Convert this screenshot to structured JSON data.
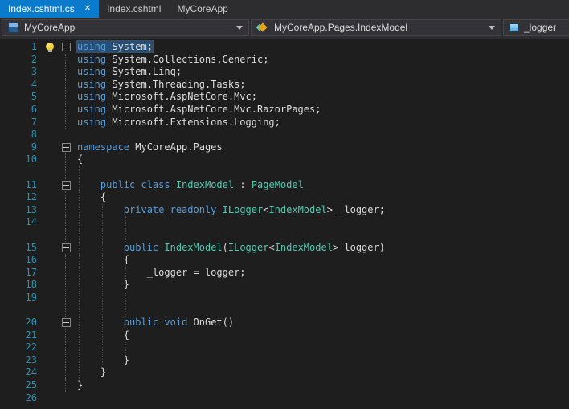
{
  "colors": {
    "bg": "#1e1e1e",
    "tabbar": "#2d2d30",
    "accent": "#0a7acc",
    "nav": "#2d2d30",
    "navbox": "#333337",
    "navborder": "#45454a",
    "lineno": "#2b91af",
    "kw": "#569cd6",
    "type": "#4ec9b0",
    "plain": "#dcdcdc",
    "sel": "#264f78"
  },
  "ui": {
    "close_glyph": "✕"
  },
  "tabs": [
    {
      "label": "Index.cshtml.cs",
      "active": true
    },
    {
      "label": "Index.cshtml",
      "active": false
    },
    {
      "label": "MyCoreApp",
      "active": false
    }
  ],
  "navbar": {
    "project": "MyCoreApp",
    "type": "MyCoreApp.Pages.IndexModel",
    "member": "_logger"
  },
  "editor": {
    "lines": [
      {
        "num": "1",
        "ol": "box",
        "bulb": true,
        "sel": true,
        "tokens": [
          [
            "k",
            "using"
          ],
          [
            "p",
            " System;"
          ]
        ]
      },
      {
        "num": "2",
        "ol": "line",
        "tokens": [
          [
            "k",
            "using"
          ],
          [
            "p",
            " System.Collections.Generic;"
          ]
        ]
      },
      {
        "num": "3",
        "ol": "line",
        "tokens": [
          [
            "k",
            "using"
          ],
          [
            "p",
            " System.Linq;"
          ]
        ]
      },
      {
        "num": "4",
        "ol": "line",
        "tokens": [
          [
            "k",
            "using"
          ],
          [
            "p",
            " System.Threading.Tasks;"
          ]
        ]
      },
      {
        "num": "5",
        "ol": "line",
        "tokens": [
          [
            "k",
            "using"
          ],
          [
            "p",
            " Microsoft.AspNetCore.Mvc;"
          ]
        ]
      },
      {
        "num": "6",
        "ol": "line",
        "tokens": [
          [
            "k",
            "using"
          ],
          [
            "p",
            " Microsoft.AspNetCore.Mvc.RazorPages;"
          ]
        ]
      },
      {
        "num": "7",
        "ol": "line",
        "tokens": [
          [
            "k",
            "using"
          ],
          [
            "p",
            " Microsoft.Extensions.Logging;"
          ]
        ]
      },
      {
        "num": "8",
        "tokens": []
      },
      {
        "num": "9",
        "ol": "box",
        "tokens": [
          [
            "k",
            "namespace"
          ],
          [
            "p",
            " MyCoreApp.Pages"
          ]
        ]
      },
      {
        "num": "10",
        "ol": "line",
        "tokens": [
          [
            "p",
            "{"
          ]
        ]
      },
      {
        "ol": "line",
        "guides": [
          0
        ],
        "tokens": []
      },
      {
        "num": "11",
        "ol": "box",
        "guides": [
          0
        ],
        "tokens": [
          [
            "p",
            "    "
          ],
          [
            "k",
            "public"
          ],
          [
            "p",
            " "
          ],
          [
            "k",
            "class"
          ],
          [
            "p",
            " "
          ],
          [
            "t",
            "IndexModel"
          ],
          [
            "p",
            " : "
          ],
          [
            "t",
            "PageModel"
          ]
        ]
      },
      {
        "num": "12",
        "ol": "line",
        "guides": [
          0
        ],
        "tokens": [
          [
            "p",
            "    {"
          ]
        ]
      },
      {
        "num": "13",
        "ol": "line",
        "guides": [
          0,
          1
        ],
        "tokens": [
          [
            "p",
            "        "
          ],
          [
            "k",
            "private"
          ],
          [
            "p",
            " "
          ],
          [
            "k",
            "readonly"
          ],
          [
            "p",
            " "
          ],
          [
            "t",
            "ILogger"
          ],
          [
            "p",
            "<"
          ],
          [
            "t",
            "IndexModel"
          ],
          [
            "p",
            "> _logger;"
          ]
        ]
      },
      {
        "num": "14",
        "ol": "line",
        "guides": [
          0,
          1,
          2
        ],
        "tokens": []
      },
      {
        "ol": "line",
        "guides": [
          0,
          1,
          2
        ],
        "tokens": []
      },
      {
        "num": "15",
        "ol": "box",
        "guides": [
          0,
          1
        ],
        "tokens": [
          [
            "p",
            "        "
          ],
          [
            "k",
            "public"
          ],
          [
            "p",
            " "
          ],
          [
            "t",
            "IndexModel"
          ],
          [
            "p",
            "("
          ],
          [
            "t",
            "ILogger"
          ],
          [
            "p",
            "<"
          ],
          [
            "t",
            "IndexModel"
          ],
          [
            "p",
            "> logger)"
          ]
        ]
      },
      {
        "num": "16",
        "ol": "line",
        "guides": [
          0,
          1
        ],
        "tokens": [
          [
            "p",
            "        {"
          ]
        ]
      },
      {
        "num": "17",
        "ol": "line",
        "guides": [
          0,
          1,
          2
        ],
        "tokens": [
          [
            "p",
            "            _logger = logger;"
          ]
        ]
      },
      {
        "num": "18",
        "ol": "line",
        "guides": [
          0,
          1
        ],
        "tokens": [
          [
            "p",
            "        }"
          ]
        ]
      },
      {
        "num": "19",
        "ol": "line",
        "guides": [
          0,
          1,
          2
        ],
        "tokens": []
      },
      {
        "ol": "line",
        "guides": [
          0,
          1,
          2
        ],
        "tokens": []
      },
      {
        "num": "20",
        "ol": "box",
        "guides": [
          0,
          1
        ],
        "tokens": [
          [
            "p",
            "        "
          ],
          [
            "k",
            "public"
          ],
          [
            "p",
            " "
          ],
          [
            "k",
            "void"
          ],
          [
            "p",
            " OnGet()"
          ]
        ]
      },
      {
        "num": "21",
        "ol": "line",
        "guides": [
          0,
          1
        ],
        "tokens": [
          [
            "p",
            "        {"
          ]
        ]
      },
      {
        "num": "22",
        "ol": "line",
        "guides": [
          0,
          1,
          2
        ],
        "tokens": []
      },
      {
        "num": "23",
        "ol": "line",
        "guides": [
          0,
          1
        ],
        "tokens": [
          [
            "p",
            "        }"
          ]
        ]
      },
      {
        "num": "24",
        "ol": "line",
        "guides": [
          0
        ],
        "tokens": [
          [
            "p",
            "    }"
          ]
        ]
      },
      {
        "num": "25",
        "ol": "line",
        "tokens": [
          [
            "p",
            "}"
          ]
        ]
      },
      {
        "num": "26",
        "tokens": []
      }
    ]
  }
}
